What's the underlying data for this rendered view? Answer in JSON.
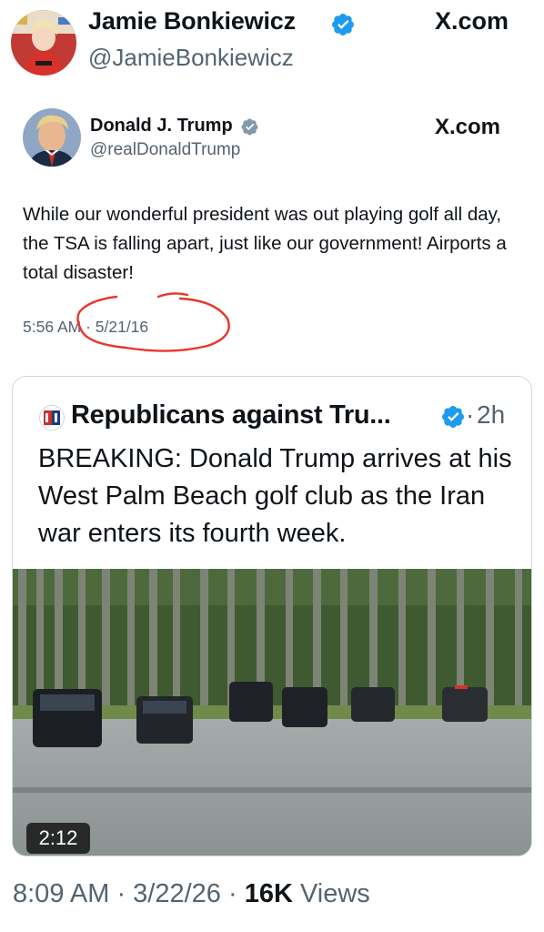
{
  "header": {
    "name": "Jamie Bonkiewicz",
    "handle": "@JamieBonkiewicz",
    "source": "X.com"
  },
  "old_tweet": {
    "name": "Donald J. Trump",
    "handle": "@realDonaldTrump",
    "source": "X.com",
    "text": "While our wonderful president was out playing golf all day, the TSA is falling apart, just like our government! Airports a total disaster!",
    "timestamp": "5:56 AM · 5/21/16",
    "annotation_color": "#e8362a"
  },
  "quoted_post": {
    "name": "Republicans against Tru...",
    "separator": "·",
    "time_ago": "2h",
    "text": "BREAKING: Donald Trump arrives at his West Palm Beach golf club as the Iran war enters its fourth week.",
    "video_duration": "2:12"
  },
  "footer": {
    "timestamp": "8:09 AM · 3/22/26 · ",
    "views_count": "16K",
    "views_label": " Views"
  },
  "colors": {
    "verified": "#1d9bf0",
    "secondary_text": "#536471",
    "primary_text": "#0f1419",
    "card_border": "#cfd9de"
  }
}
